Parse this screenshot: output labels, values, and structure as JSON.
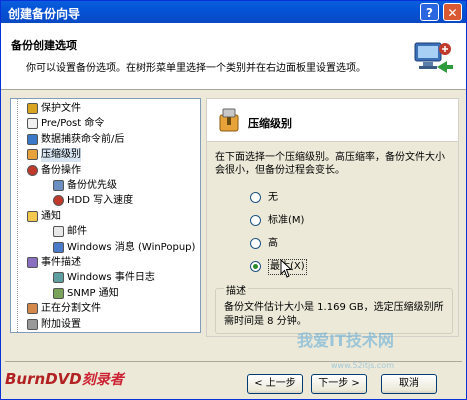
{
  "window": {
    "title": "创建备份向导",
    "help_label": "?",
    "close_label": "✕"
  },
  "header": {
    "title": "备份创建选项",
    "subtitle": "你可以设置备份选项。在树形菜单里选择一个类别并在右边面板里设置选项。"
  },
  "tree": {
    "items": [
      {
        "label": "保护文件",
        "icon": "lock-icon",
        "level": 0
      },
      {
        "label": "Pre/Post 命令",
        "icon": "document-icon",
        "level": 0
      },
      {
        "label": "数据捕获命令前/后",
        "icon": "database-icon",
        "level": 0
      },
      {
        "label": "压缩级别",
        "icon": "compress-icon",
        "level": 0,
        "selected": true
      },
      {
        "label": "备份操作",
        "icon": "stop-icon",
        "level": 0
      },
      {
        "label": "备份优先级",
        "icon": "priority-icon",
        "level": 1
      },
      {
        "label": "HDD 写入速度",
        "icon": "stop-icon",
        "level": 1
      },
      {
        "label": "通知",
        "icon": "message-icon",
        "level": 0
      },
      {
        "label": "邮件",
        "icon": "mail-icon",
        "level": 1
      },
      {
        "label": "Windows 消息 (WinPopup)",
        "icon": "window-icon",
        "level": 1
      },
      {
        "label": "事件描述",
        "icon": "event-icon",
        "level": 0
      },
      {
        "label": "Windows 事件日志",
        "icon": "log-icon",
        "level": 1
      },
      {
        "label": "SNMP 通知",
        "icon": "snmp-icon",
        "level": 1
      },
      {
        "label": "正在分割文件",
        "icon": "split-icon",
        "level": 0
      },
      {
        "label": "附加设置",
        "icon": "gear-icon",
        "level": 0
      }
    ]
  },
  "panel": {
    "title": "压缩级别",
    "description": "在下面选择一个压缩级别。高压缩率，备份文件大小会很小，但备份过程会变长。",
    "options": [
      {
        "label": "无",
        "checked": false
      },
      {
        "label": "标准(M)",
        "checked": false
      },
      {
        "label": "高",
        "checked": false
      },
      {
        "label": "最大(X)",
        "checked": true
      }
    ],
    "desc_legend": "描述",
    "desc_text": "备份文件估计大小是 1.169 GB，选定压缩级别所需时间是 8 分钟。"
  },
  "buttons": {
    "back": "< 上一步",
    "next": "下一步 >",
    "cancel": "取消"
  },
  "watermarks": {
    "left_en": "BurnDVD",
    "left_cn": "刻录者",
    "right": "我爱IT技术网",
    "url": "www.52itjs.com"
  },
  "colors": {
    "titlebar": "#0453d6",
    "close": "#d95a32",
    "radio_check": "#2b8a2b"
  }
}
